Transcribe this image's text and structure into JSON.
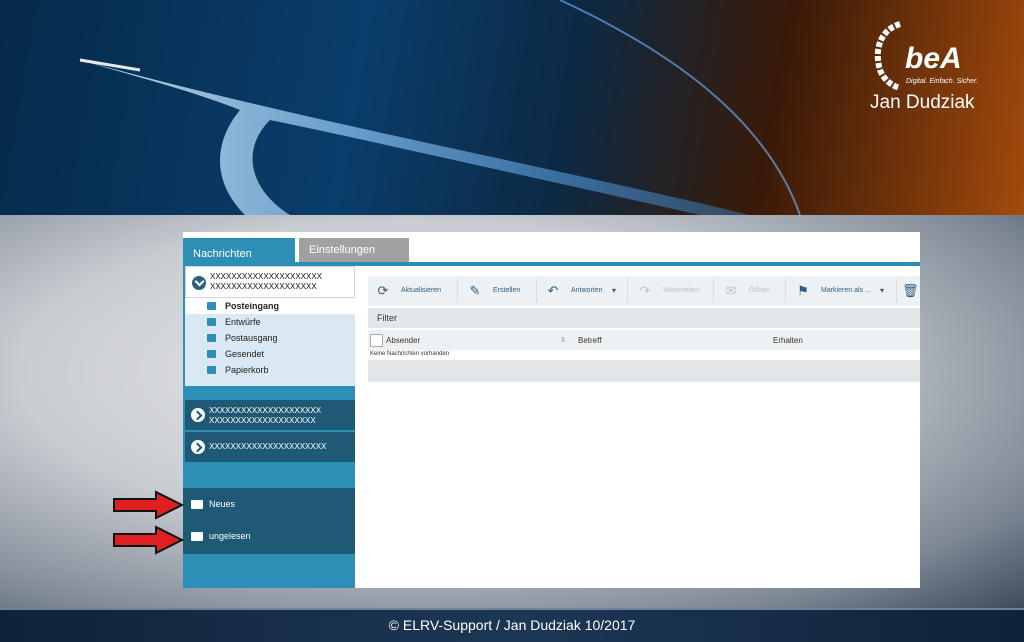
{
  "banner": {
    "logo_text": "beA",
    "logo_tagline": "Digital. Einfach. Sicher.",
    "author": "Jan Dudziak"
  },
  "app": {
    "tabs": [
      {
        "label": "Nachrichten",
        "active": true
      },
      {
        "label": "Einstellungen",
        "active": false
      }
    ],
    "accounts": [
      {
        "line1": "XXXXXXXXXXXXXXXXXXXXX",
        "line2": "XXXXXXXXXXXXXXXXXXXX"
      },
      {
        "line1": "XXXXXXXXXXXXXXXXXXXXX",
        "line2": "XXXXXXXXXXXXXXXXXXXX"
      },
      {
        "line1": "XXXXXXXXXXXXXXXXXXXXXX"
      }
    ],
    "folders": [
      {
        "label": "Posteingang",
        "selected": true
      },
      {
        "label": "Entwürfe"
      },
      {
        "label": "Postausgang"
      },
      {
        "label": "Gesendet"
      },
      {
        "label": "Papierkorb"
      }
    ],
    "lower_folders": [
      {
        "label": "Neues"
      },
      {
        "label": "ungelesen"
      }
    ],
    "toolbar": [
      {
        "label": "Aktualisieren",
        "icon": "refresh-icon",
        "enabled": true
      },
      {
        "label": "Erstellen",
        "icon": "pencil-icon",
        "enabled": true
      },
      {
        "label": "Antworten",
        "icon": "reply-icon",
        "enabled": true
      },
      {
        "label": "Weiterleiten",
        "icon": "forward-icon",
        "enabled": false
      },
      {
        "label": "Öffnen",
        "icon": "envelope-icon",
        "enabled": false
      },
      {
        "label": "Markieren als ...",
        "icon": "bookmark-icon",
        "enabled": true
      },
      {
        "label": "",
        "icon": "trash-icon",
        "enabled": true
      }
    ],
    "filter_label": "Filter",
    "columns": [
      "Absender",
      "Betreff",
      "Erhalten"
    ],
    "empty_message": "Keine Nachrichten vorhanden"
  },
  "footer": {
    "text": "© ELRV-Support / Jan Dudziak 10/2017"
  },
  "colors": {
    "accent": "#2d8fb6",
    "dark_nav": "#1e5a76",
    "arrow": "#e02020"
  }
}
